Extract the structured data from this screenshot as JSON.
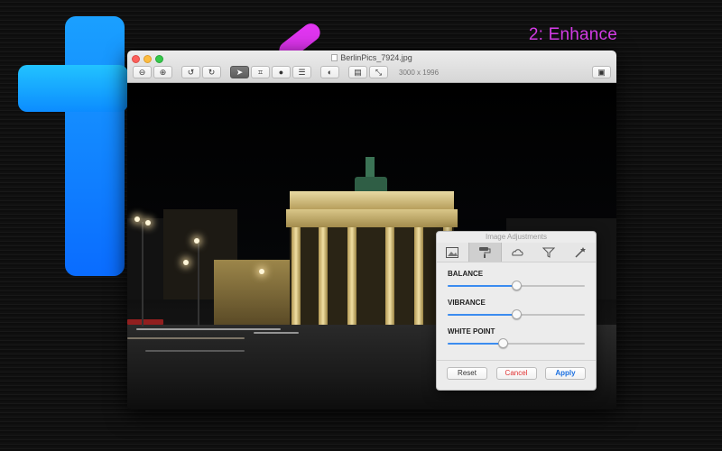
{
  "headline": "2: Enhance",
  "window": {
    "title": "BerlinPics_7924.jpg",
    "dimensions": "3000 x 1996"
  },
  "toolbar": {
    "buttons": [
      {
        "name": "zoom-out-icon",
        "glyph": "⊖"
      },
      {
        "name": "zoom-in-icon",
        "glyph": "⊕"
      },
      {
        "name": "rotate-left-icon",
        "glyph": "↺"
      },
      {
        "name": "rotate-right-icon",
        "glyph": "↻"
      },
      {
        "name": "select-arrow-icon",
        "glyph": "➤",
        "active": true
      },
      {
        "name": "crop-icon",
        "glyph": "⌗"
      },
      {
        "name": "ellipse-icon",
        "glyph": "●"
      },
      {
        "name": "adjust-sliders-icon",
        "glyph": "☰"
      },
      {
        "name": "effects-icon",
        "glyph": "◐"
      },
      {
        "name": "toolbox-icon",
        "glyph": "▤"
      },
      {
        "name": "resize-icon",
        "glyph": "⤡"
      }
    ],
    "save_glyph": "▣"
  },
  "panel": {
    "title": "Image Adjustments",
    "tabs": [
      {
        "name": "tab-image-icon",
        "glyph": "▧"
      },
      {
        "name": "tab-paint-roller-icon",
        "glyph": "⎍",
        "active": true
      },
      {
        "name": "tab-drop-icon",
        "glyph": "☁"
      },
      {
        "name": "tab-filter-icon",
        "glyph": "⏷"
      },
      {
        "name": "tab-magic-wand-icon",
        "glyph": "✧"
      }
    ],
    "sliders": [
      {
        "label": "BALANCE",
        "value": 0.5
      },
      {
        "label": "VIBRANCE",
        "value": 0.5
      },
      {
        "label": "WHITE POINT",
        "value": 0.4
      }
    ],
    "buttons": {
      "reset": "Reset",
      "cancel": "Cancel",
      "apply": "Apply"
    }
  },
  "colors": {
    "accent_blue": "#0a84ff",
    "headline_magenta": "#d63ce8",
    "cancel_red": "#e03030",
    "apply_blue": "#1a6fe0"
  }
}
